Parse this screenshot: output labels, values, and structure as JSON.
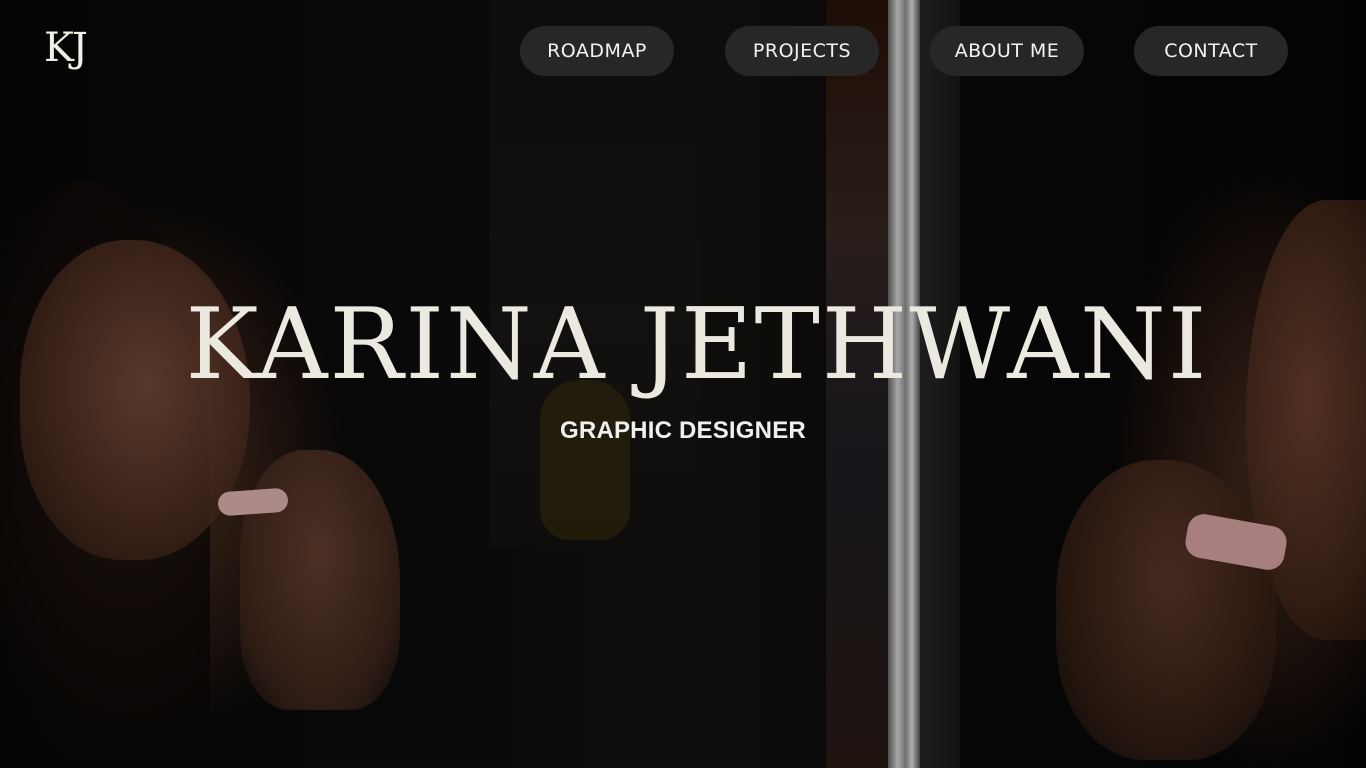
{
  "header": {
    "logo_text": "KJ"
  },
  "nav": {
    "items": [
      {
        "label": "ROADMAP"
      },
      {
        "label": "PROJECTS"
      },
      {
        "label": "ABOUT ME"
      },
      {
        "label": "CONTACT"
      }
    ]
  },
  "hero": {
    "title": "KARINA JETHWANI",
    "subtitle": "GRAPHIC DESIGNER"
  },
  "colors": {
    "nav_button_bg": "#272727",
    "text_light": "#eceae0"
  }
}
